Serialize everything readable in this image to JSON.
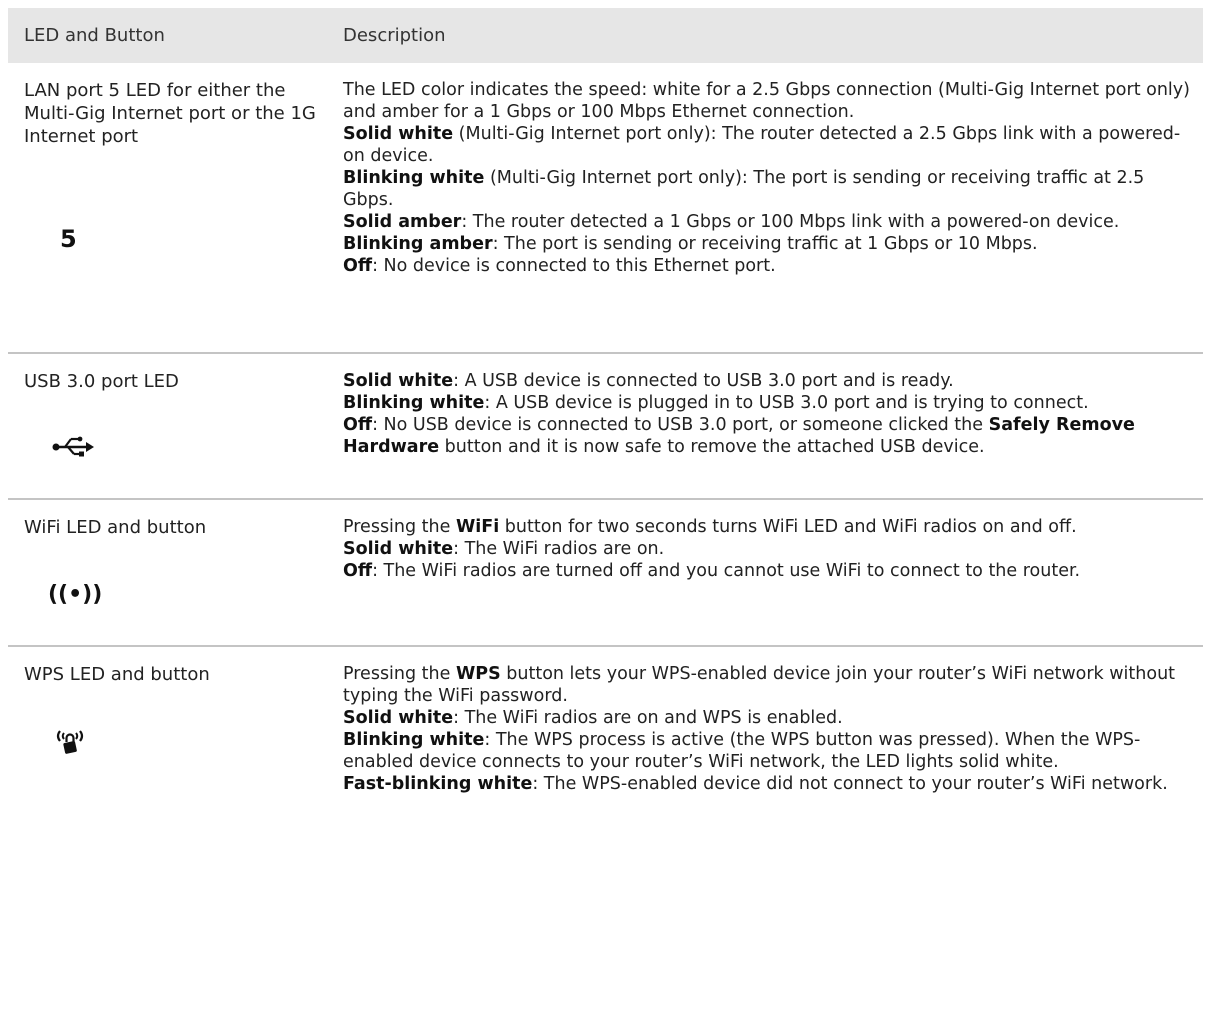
{
  "table": {
    "headers": [
      "LED and Button",
      "Description"
    ],
    "rows": [
      {
        "left_label": "LAN port 5 LED for either the Multi-Gig Internet port or the 1G Internet port",
        "icon_name": "number-5-icon",
        "icon_text": "5",
        "lines": [
          [
            {
              "t": "The LED color indicates the speed: white for a 2.5 Gbps connection (Multi-Gig Internet port only) and amber for a 1 Gbps or 100 Mbps Ethernet connection.",
              "b": false
            }
          ],
          [
            {
              "t": "Solid white",
              "b": true
            },
            {
              "t": " (Multi-Gig Internet port only): The router detected a 2.5 Gbps link with a powered-on device.",
              "b": false
            }
          ],
          [
            {
              "t": "Blinking white",
              "b": true
            },
            {
              "t": " (Multi-Gig Internet port only): The port is sending or receiving traffic at 2.5 Gbps.",
              "b": false
            }
          ],
          [
            {
              "t": "Solid amber",
              "b": true
            },
            {
              "t": ": The router detected a 1 Gbps or 100 Mbps link with a powered-on device.",
              "b": false
            }
          ],
          [
            {
              "t": "Blinking amber",
              "b": true
            },
            {
              "t": ": The port is sending or receiving traffic at 1 Gbps or 10 Mbps.",
              "b": false
            }
          ],
          [
            {
              "t": "Off",
              "b": true
            },
            {
              "t": ": No device is connected to this Ethernet port.",
              "b": false
            }
          ]
        ]
      },
      {
        "left_label": "USB 3.0 port LED",
        "icon_name": "usb-icon",
        "icon_text": "",
        "lines": [
          [
            {
              "t": "Solid white",
              "b": true
            },
            {
              "t": ": A USB device is connected to USB 3.0 port and is ready.",
              "b": false
            }
          ],
          [
            {
              "t": "Blinking white",
              "b": true
            },
            {
              "t": ": A USB device is plugged in to USB 3.0 port and is trying to connect.",
              "b": false
            }
          ],
          [
            {
              "t": "Off",
              "b": true
            },
            {
              "t": ": No USB device is connected to USB 3.0 port, or someone clicked the ",
              "b": false
            },
            {
              "t": "Safely Remove Hardware",
              "b": true
            },
            {
              "t": " button and it is now safe to remove the attached USB device.",
              "b": false
            }
          ]
        ]
      },
      {
        "left_label": "WiFi LED and button",
        "icon_name": "wifi-icon",
        "icon_text": "((•))",
        "lines": [
          [
            {
              "t": "Pressing the ",
              "b": false
            },
            {
              "t": "WiFi",
              "b": true
            },
            {
              "t": " button for two seconds turns WiFi LED and WiFi radios on and off.",
              "b": false
            }
          ],
          [
            {
              "t": "Solid white",
              "b": true
            },
            {
              "t": ": The WiFi radios are on.",
              "b": false
            }
          ],
          [
            {
              "t": "Off",
              "b": true
            },
            {
              "t": ": The WiFi radios are turned off and you cannot use WiFi to connect to the router.",
              "b": false
            }
          ]
        ]
      },
      {
        "left_label": "WPS LED and button",
        "icon_name": "wps-lock-icon",
        "icon_text": "",
        "lines": [
          [
            {
              "t": "Pressing the ",
              "b": false
            },
            {
              "t": "WPS",
              "b": true
            },
            {
              "t": " button lets your WPS-enabled device join your router’s WiFi network without typing the WiFi password.",
              "b": false
            }
          ],
          [
            {
              "t": "Solid white",
              "b": true
            },
            {
              "t": ": The WiFi radios are on and WPS is enabled.",
              "b": false
            }
          ],
          [
            {
              "t": "Blinking white",
              "b": true
            },
            {
              "t": ": The WPS process is active (the WPS button was pressed). When the WPS-enabled device connects to your router’s WiFi network, the LED lights solid white.",
              "b": false
            }
          ],
          [
            {
              "t": "Fast-blinking white",
              "b": true
            },
            {
              "t": ": The WPS-enabled device did not connect to your router’s WiFi network.",
              "b": false
            }
          ]
        ]
      }
    ]
  },
  "colors": {
    "header_background": "#e6e6e6",
    "divider": "#c4c4c4",
    "text": "#222222"
  }
}
